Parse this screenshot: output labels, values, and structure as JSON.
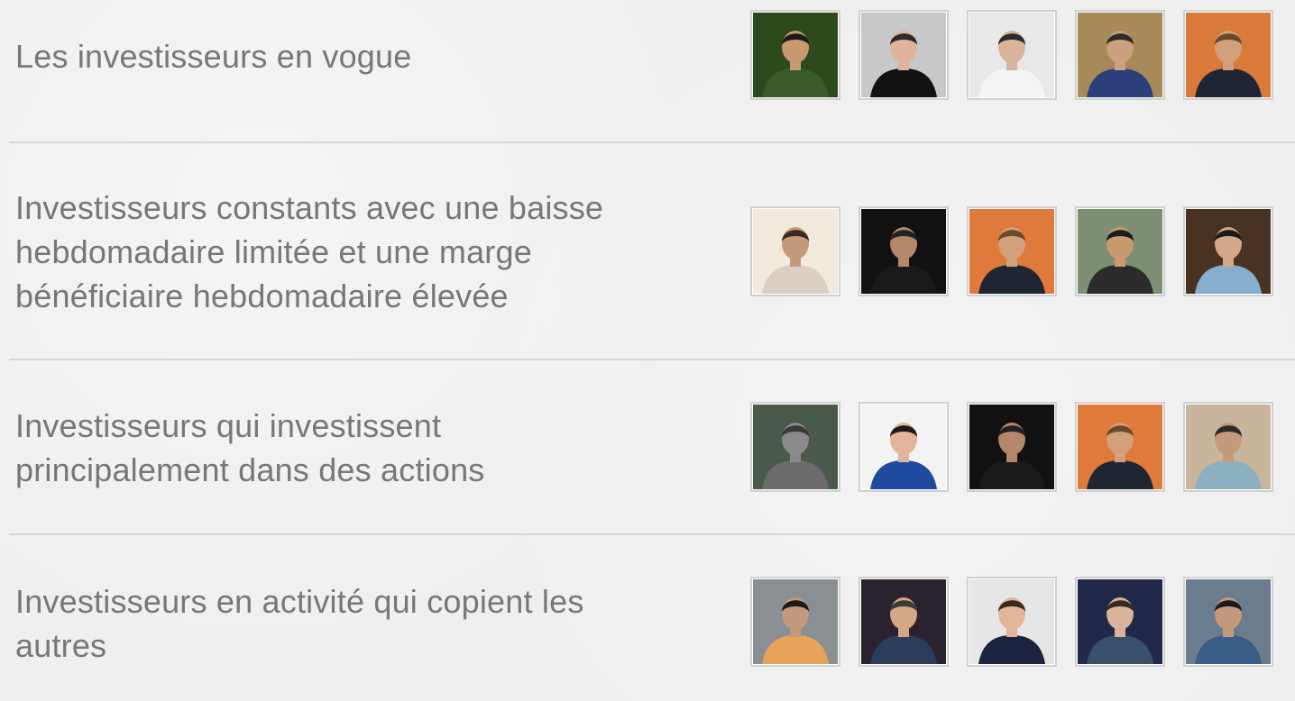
{
  "sections": [
    {
      "title": "Les investisseurs en vogue",
      "avatars": [
        {
          "label": "investor-avatar",
          "bg": "#2d4a1f",
          "skin": "#c79a72",
          "shirt": "#3a5a2a",
          "hair": "#1a1a1a"
        },
        {
          "label": "investor-avatar",
          "bg": "#c8c8c8",
          "skin": "#e0b49a",
          "shirt": "#111111",
          "hair": "#2a2a2a"
        },
        {
          "label": "investor-avatar",
          "bg": "#e8e8e8",
          "skin": "#d9b39a",
          "shirt": "#f4f4f4",
          "hair": "#2b2b2b"
        },
        {
          "label": "investor-avatar",
          "bg": "#a88a58",
          "skin": "#caa07e",
          "shirt": "#2d3f7a",
          "hair": "#2b2b2b"
        },
        {
          "label": "investor-avatar",
          "bg": "#d97a3a",
          "skin": "#d3a07c",
          "shirt": "#1f2533",
          "hair": "#6a4a2a"
        }
      ]
    },
    {
      "title": "Investisseurs constants avec une baisse hebdomadaire limitée et une marge bénéficiaire hebdomadaire élevée",
      "avatars": [
        {
          "label": "investor-avatar",
          "bg": "#f1e9dc",
          "skin": "#c49a7c",
          "shirt": "#d9cfc2",
          "hair": "#3a2a22"
        },
        {
          "label": "investor-avatar",
          "bg": "#111111",
          "skin": "#b5876a",
          "shirt": "#1a1a1a",
          "hair": "#222222"
        },
        {
          "label": "investor-avatar",
          "bg": "#e07a3a",
          "skin": "#d3a07c",
          "shirt": "#1f2533",
          "hair": "#6a4a2a"
        },
        {
          "label": "investor-avatar",
          "bg": "#7e8f74",
          "skin": "#c79a72",
          "shirt": "#2b2b2b",
          "hair": "#1b1b1b"
        },
        {
          "label": "investor-avatar",
          "bg": "#4a3222",
          "skin": "#d2a886",
          "shirt": "#87aecf",
          "hair": "#1b1b1b"
        }
      ]
    },
    {
      "title": "Investisseurs qui investissent principalement dans des actions",
      "avatars": [
        {
          "label": "investor-avatar",
          "bg": "#4a5a4a",
          "skin": "#8a8a8a",
          "shirt": "#6b6b6b",
          "hair": "#3a3a3a"
        },
        {
          "label": "investor-avatar",
          "bg": "#f3f3f3",
          "skin": "#e2b59a",
          "shirt": "#1e4aa0",
          "hair": "#1b1b1b"
        },
        {
          "label": "investor-avatar",
          "bg": "#111111",
          "skin": "#b5876a",
          "shirt": "#1a1a1a",
          "hair": "#222222"
        },
        {
          "label": "investor-avatar",
          "bg": "#e07a3a",
          "skin": "#d3a07c",
          "shirt": "#1f2533",
          "hair": "#6a4a2a"
        },
        {
          "label": "investor-avatar",
          "bg": "#c9b59c",
          "skin": "#c49a7c",
          "shirt": "#8bb0c0",
          "hair": "#2a2a2a"
        }
      ]
    },
    {
      "title": "Investisseurs en activité qui copient les autres",
      "avatars": [
        {
          "label": "investor-avatar",
          "bg": "#8a8f93",
          "skin": "#c49a7c",
          "shirt": "#e7a35a",
          "hair": "#1b1b1b"
        },
        {
          "label": "investor-avatar",
          "bg": "#2b2230",
          "skin": "#d2a886",
          "shirt": "#2b3d5b",
          "hair": "#3a3a3a"
        },
        {
          "label": "investor-avatar",
          "bg": "#e6e6e6",
          "skin": "#e2b59a",
          "shirt": "#1b2340",
          "hair": "#3a2a22"
        },
        {
          "label": "investor-avatar",
          "bg": "#21294a",
          "skin": "#d9b39a",
          "shirt": "#3a4f6a",
          "hair": "#3a2a22"
        },
        {
          "label": "investor-avatar",
          "bg": "#6c7c8f",
          "skin": "#c49a7c",
          "shirt": "#3a5f86",
          "hair": "#1b1b1b"
        }
      ]
    }
  ]
}
